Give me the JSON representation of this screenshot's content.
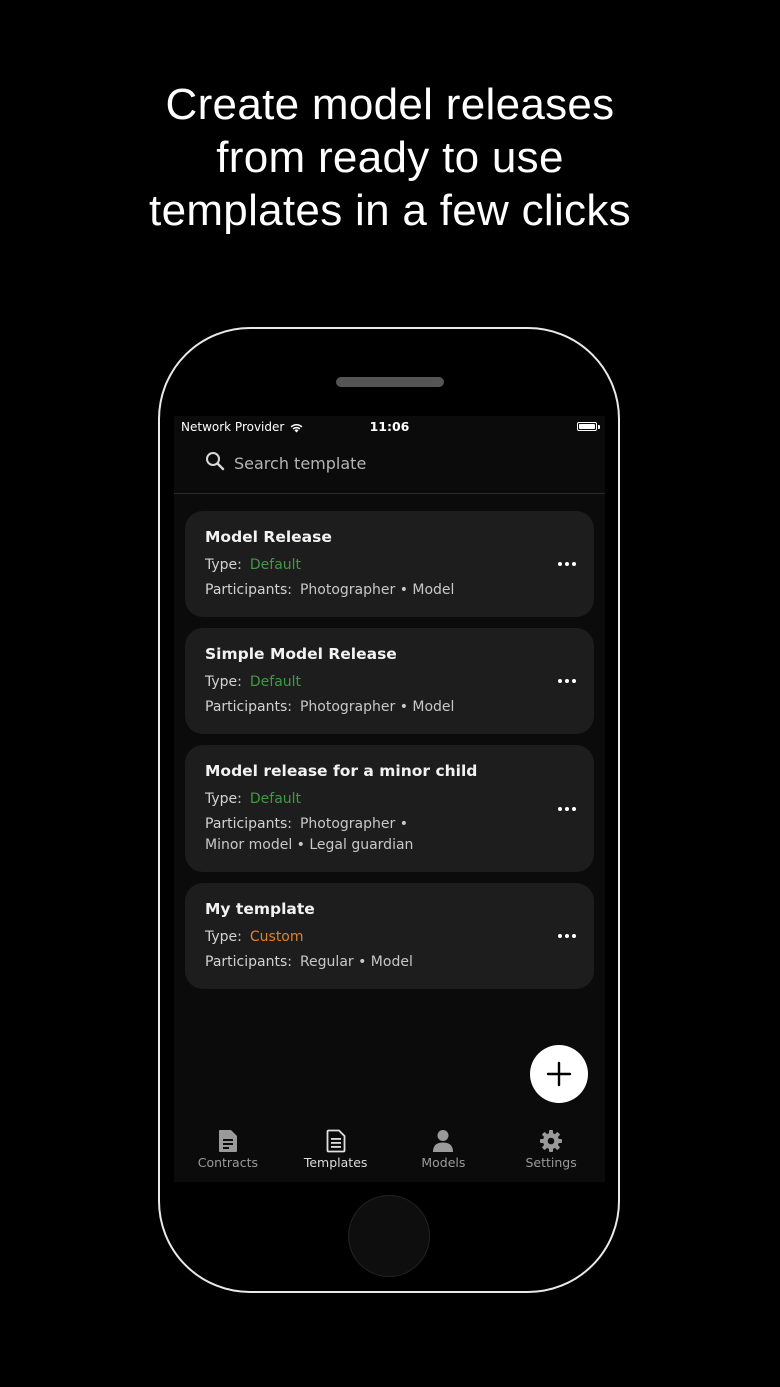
{
  "headline": {
    "line1": "Create model releases",
    "line2": "from ready to use",
    "line3": "templates in a few clicks"
  },
  "status_bar": {
    "carrier": "Network Provider",
    "time": "11:06",
    "battery_percent": 100
  },
  "search": {
    "placeholder": "Search template",
    "value": ""
  },
  "templates": [
    {
      "title": "Model Release",
      "type_label": "Type:",
      "type_value": "Default",
      "participants_label": "Participants:",
      "participants_value": "Photographer • Model"
    },
    {
      "title": "Simple Model Release",
      "type_label": "Type:",
      "type_value": "Default",
      "participants_label": "Participants:",
      "participants_value": "Photographer • Model"
    },
    {
      "title": "Model release for a minor child",
      "type_label": "Type:",
      "type_value": "Default",
      "participants_label": "Participants:",
      "participants_value": "Photographer •",
      "participants_value_line2": "Minor model • Legal guardian"
    },
    {
      "title": "My template",
      "type_label": "Type:",
      "type_value": "Custom",
      "participants_label": "Participants:",
      "participants_value": "Regular • Model"
    }
  ],
  "tabbar": {
    "contracts": "Contracts",
    "templates": "Templates",
    "models": "Models",
    "settings": "Settings",
    "active": "templates"
  },
  "colors": {
    "default_type": "#3f9a44",
    "custom_type": "#e0822e",
    "card_bg": "#1d1d1d"
  }
}
